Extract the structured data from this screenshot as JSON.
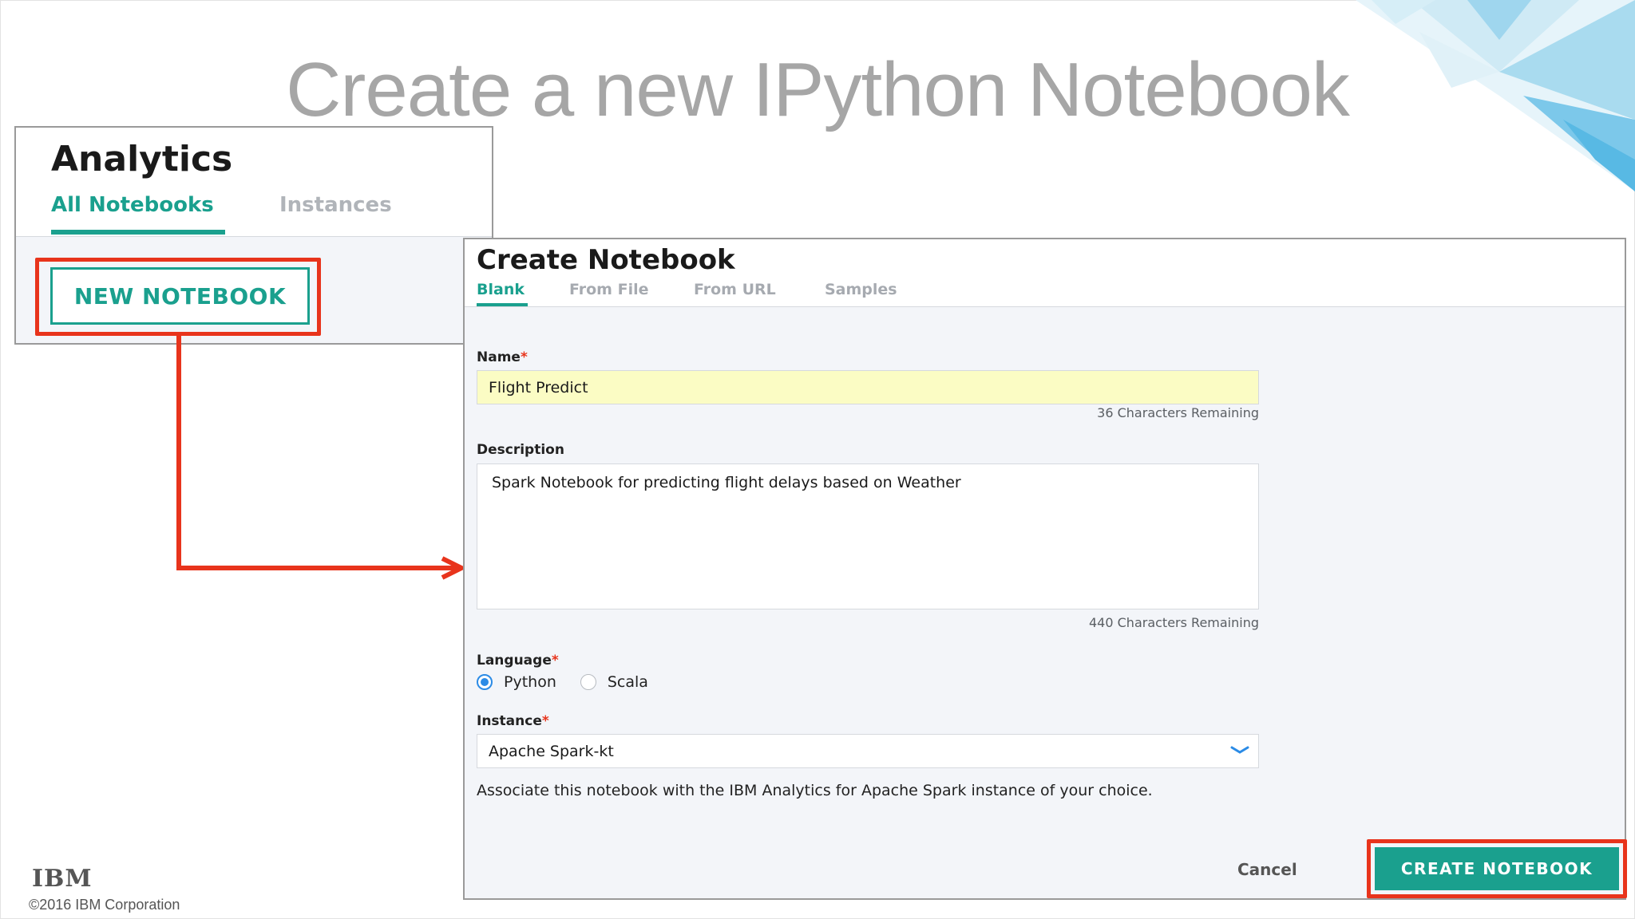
{
  "slide": {
    "title": "Create a new IPython Notebook",
    "footer_logo": "IBM",
    "copyright": "©2016 IBM Corporation"
  },
  "analytics": {
    "title": "Analytics",
    "tabs": [
      {
        "label": "All Notebooks",
        "active": true
      },
      {
        "label": "Instances",
        "active": false
      }
    ],
    "new_notebook_label": "NEW NOTEBOOK"
  },
  "dialog": {
    "title": "Create Notebook",
    "tabs": [
      {
        "label": "Blank",
        "active": true
      },
      {
        "label": "From File",
        "active": false
      },
      {
        "label": "From URL",
        "active": false
      },
      {
        "label": "Samples",
        "active": false
      }
    ],
    "name": {
      "label": "Name",
      "required_mark": "*",
      "value": "Flight Predict",
      "remaining": "36 Characters Remaining"
    },
    "description": {
      "label": "Description",
      "value": "Spark Notebook for predicting flight delays based on Weather",
      "remaining": "440 Characters Remaining"
    },
    "language": {
      "label": "Language",
      "required_mark": "*",
      "options": [
        {
          "label": "Python",
          "selected": true
        },
        {
          "label": "Scala",
          "selected": false
        }
      ]
    },
    "instance": {
      "label": "Instance",
      "required_mark": "*",
      "selected": "Apache Spark-kt",
      "help": "Associate this notebook with the IBM Analytics for Apache Spark instance of your choice."
    },
    "cancel_label": "Cancel",
    "create_label": "CREATE NOTEBOOK"
  },
  "colors": {
    "accent": "#1aa08e",
    "highlight": "#e8341c",
    "radio": "#2b8be6",
    "name_field_bg": "#fbfcc4"
  },
  "icons": [
    "chevron-down-icon",
    "annotation-arrow",
    "decorative-polygons"
  ]
}
